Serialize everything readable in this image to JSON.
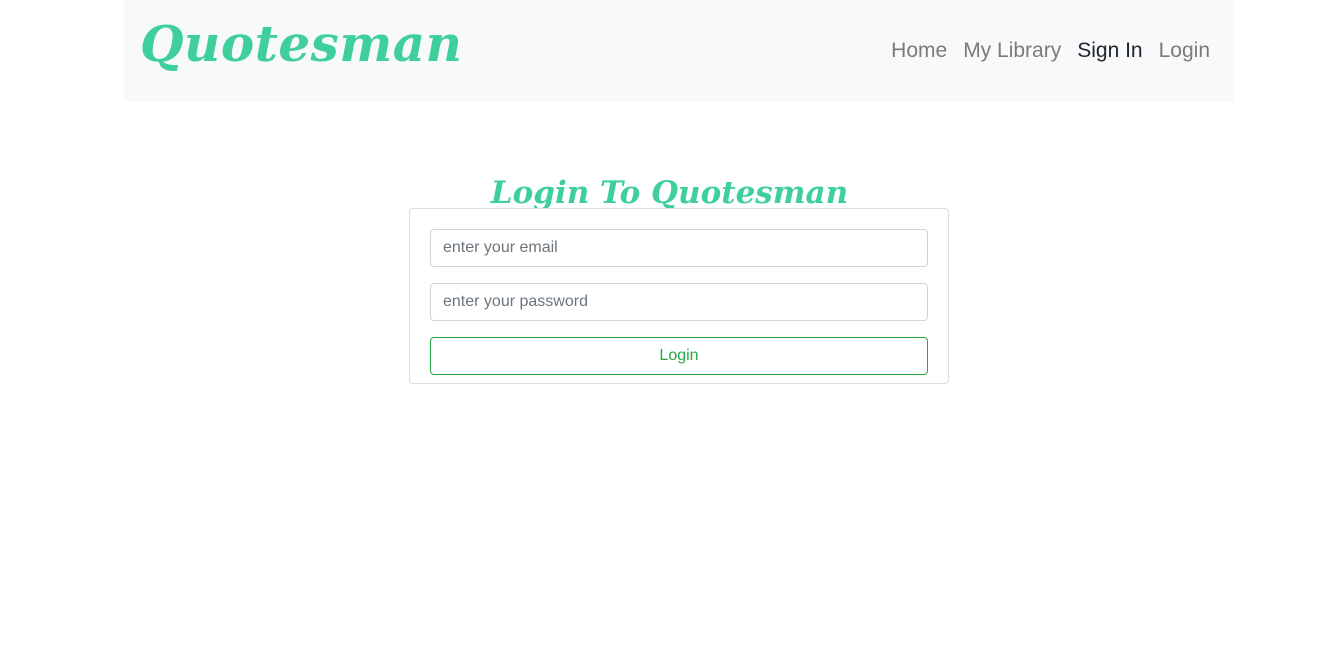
{
  "navbar": {
    "brand": "Quotesman",
    "links": [
      {
        "label": "Home"
      },
      {
        "label": "My Library"
      },
      {
        "label": "Sign In"
      },
      {
        "label": "Login"
      }
    ]
  },
  "login": {
    "heading": "Login To Quotesman",
    "email_placeholder": "enter your email",
    "password_placeholder": "enter your password",
    "button_label": "Login"
  },
  "colors": {
    "brand": "#3ecf9a",
    "navbar_bg": "#f8f9fa",
    "button_outline": "#28a745",
    "nav_link": "#7b7b7b",
    "nav_link_active": "#212529"
  }
}
